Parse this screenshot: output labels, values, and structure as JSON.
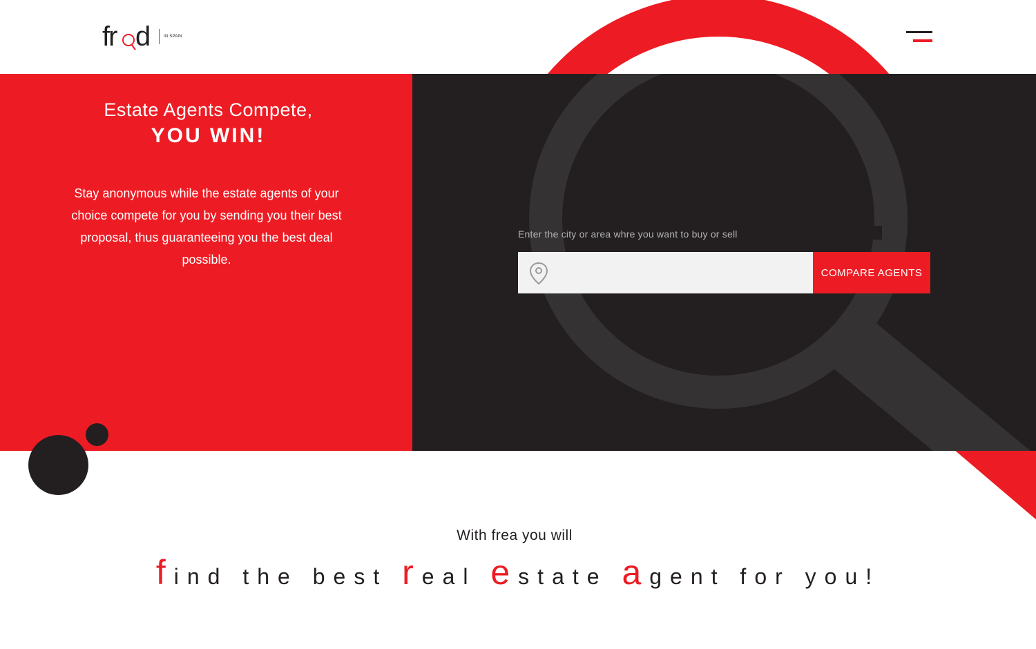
{
  "brand": {
    "logo_text": "fred",
    "logo_sub": "IN SPAIN"
  },
  "header": {
    "menu_icon": "hamburger-menu-icon"
  },
  "hero": {
    "title": "Estate Agents Compete,",
    "title_strong": "YOU WIN!",
    "description": "Stay anonymous while the estate agents of your choice compete for you by sending you their best proposal, thus guaranteeing you the best deal possible."
  },
  "search": {
    "label": "Enter the city or area whre you want to buy or sell",
    "value": "",
    "placeholder": "",
    "icon": "map-pin-icon",
    "button_label": "COMPARE AGENTS"
  },
  "tagline": {
    "intro": "With frea you will",
    "parts": [
      {
        "big": "f",
        "rest": "ind the best "
      },
      {
        "big": "r",
        "rest": "eal "
      },
      {
        "big": "e",
        "rest": "state "
      },
      {
        "big": "a",
        "rest": "gent for you!"
      }
    ]
  },
  "colors": {
    "accent": "#ed1c24",
    "dark": "#231f20",
    "ring_dark": "#343233",
    "input_bg": "#f2f2f2"
  }
}
